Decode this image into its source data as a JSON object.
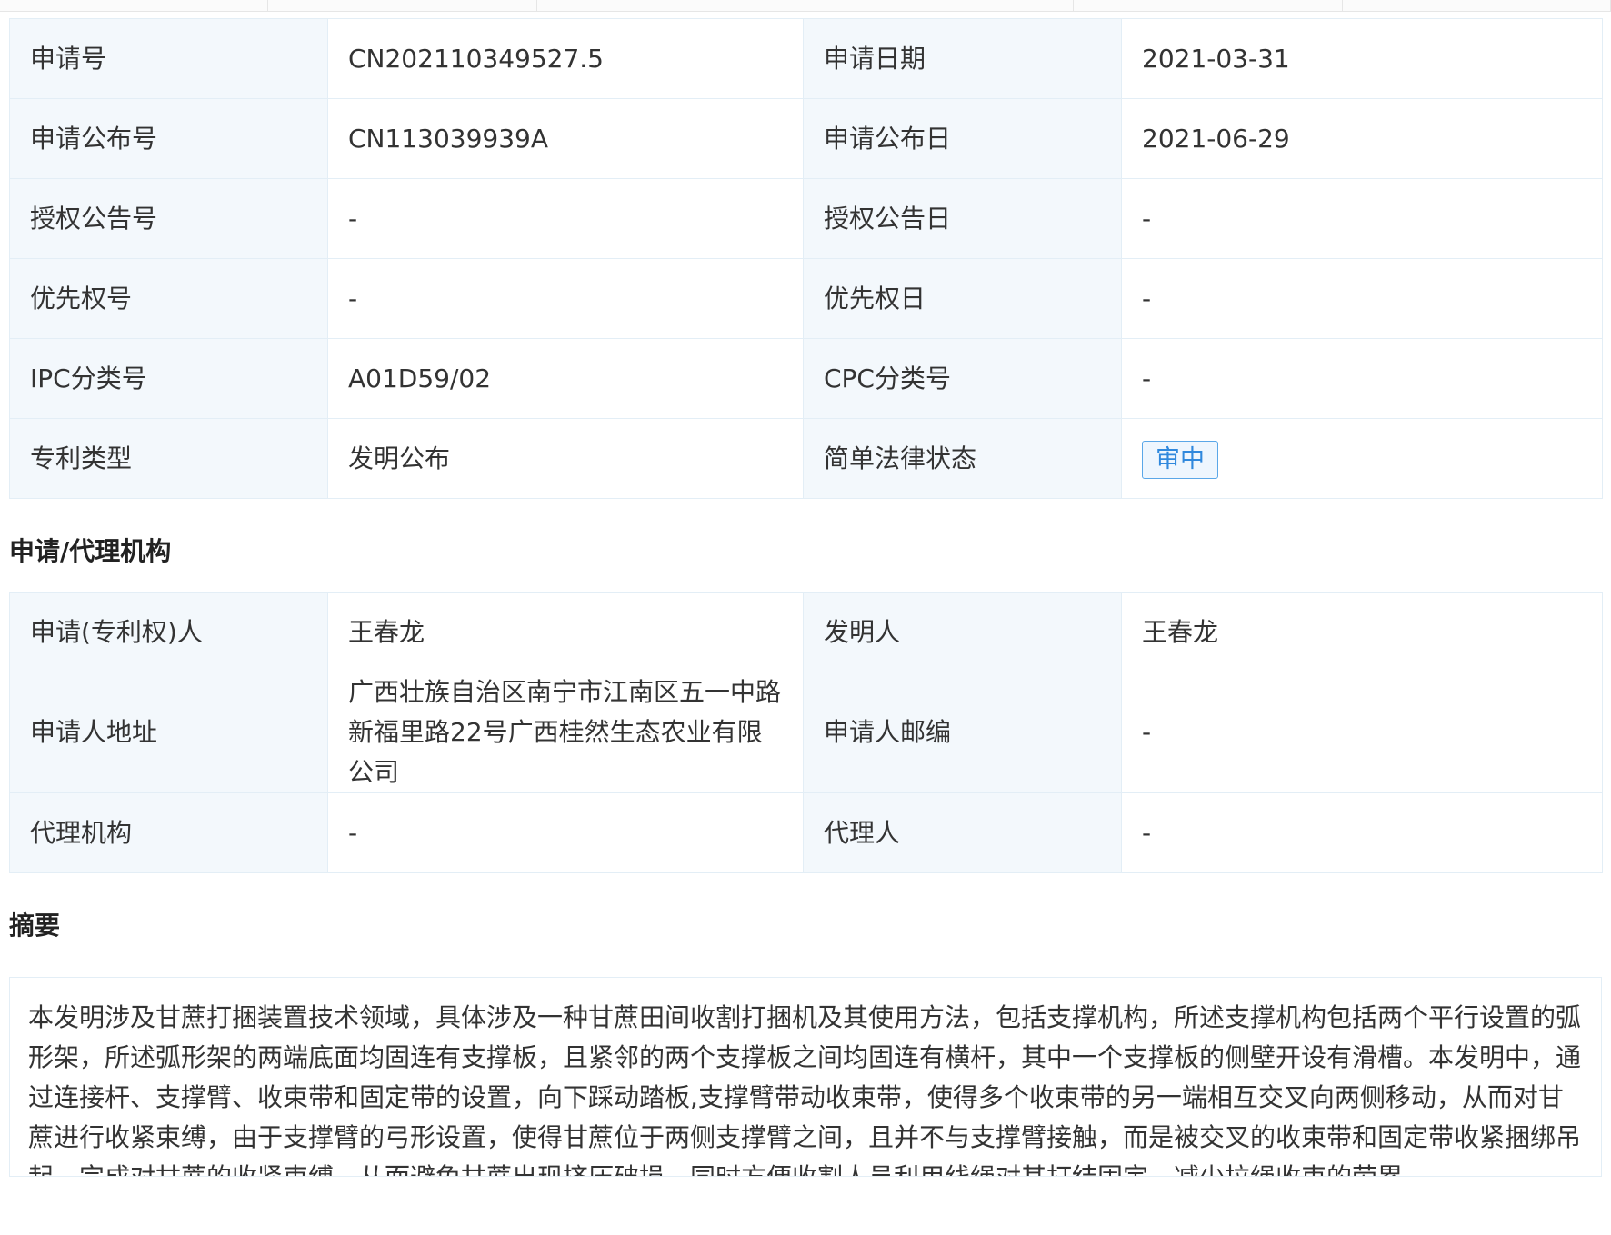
{
  "table1": {
    "rows": [
      {
        "l1": "申请号",
        "v1": "CN202110349527.5",
        "l2": "申请日期",
        "v2": "2021-03-31"
      },
      {
        "l1": "申请公布号",
        "v1": "CN113039939A",
        "l2": "申请公布日",
        "v2": "2021-06-29"
      },
      {
        "l1": "授权公告号",
        "v1": "-",
        "l2": "授权公告日",
        "v2": "-"
      },
      {
        "l1": "优先权号",
        "v1": "-",
        "l2": "优先权日",
        "v2": "-"
      },
      {
        "l1": "IPC分类号",
        "v1": "A01D59/02",
        "l2": "CPC分类号",
        "v2": "-"
      },
      {
        "l1": "专利类型",
        "v1": "发明公布",
        "l2": "简单法律状态",
        "v2": "审中"
      }
    ]
  },
  "section_agency": {
    "title": "申请/代理机构"
  },
  "table2": {
    "rows": [
      {
        "l1": "申请(专利权)人",
        "v1": "王春龙",
        "l2": "发明人",
        "v2": "王春龙"
      },
      {
        "l1": "申请人地址",
        "v1": "广西壮族自治区南宁市江南区五一中路新福里路22号广西桂然生态农业有限公司",
        "l2": "申请人邮编",
        "v2": "-"
      },
      {
        "l1": "代理机构",
        "v1": "-",
        "l2": "代理人",
        "v2": "-"
      }
    ]
  },
  "section_abstract": {
    "title": "摘要",
    "text": "本发明涉及甘蔗打捆装置技术领域，具体涉及一种甘蔗田间收割打捆机及其使用方法，包括支撑机构，所述支撑机构包括两个平行设置的弧形架，所述弧形架的两端底面均固连有支撑板，且紧邻的两个支撑板之间均固连有横杆，其中一个支撑板的侧壁开设有滑槽。本发明中，通过连接杆、支撑臂、收束带和固定带的设置，向下踩动踏板,支撑臂带动收束带，使得多个收束带的另一端相互交叉向两侧移动，从而对甘蔗进行收紧束缚，由于支撑臂的弓形设置，使得甘蔗位于两侧支撑臂之间，且并不与支撑臂接触，而是被交叉的收束带和固定带收紧捆绑吊起，完成对甘蔗的收紧束缚，从而避免甘蔗出现挤压破损，同时方便收割人员利用线绳对其打结固定，减少拉绳收束的劳累"
  }
}
